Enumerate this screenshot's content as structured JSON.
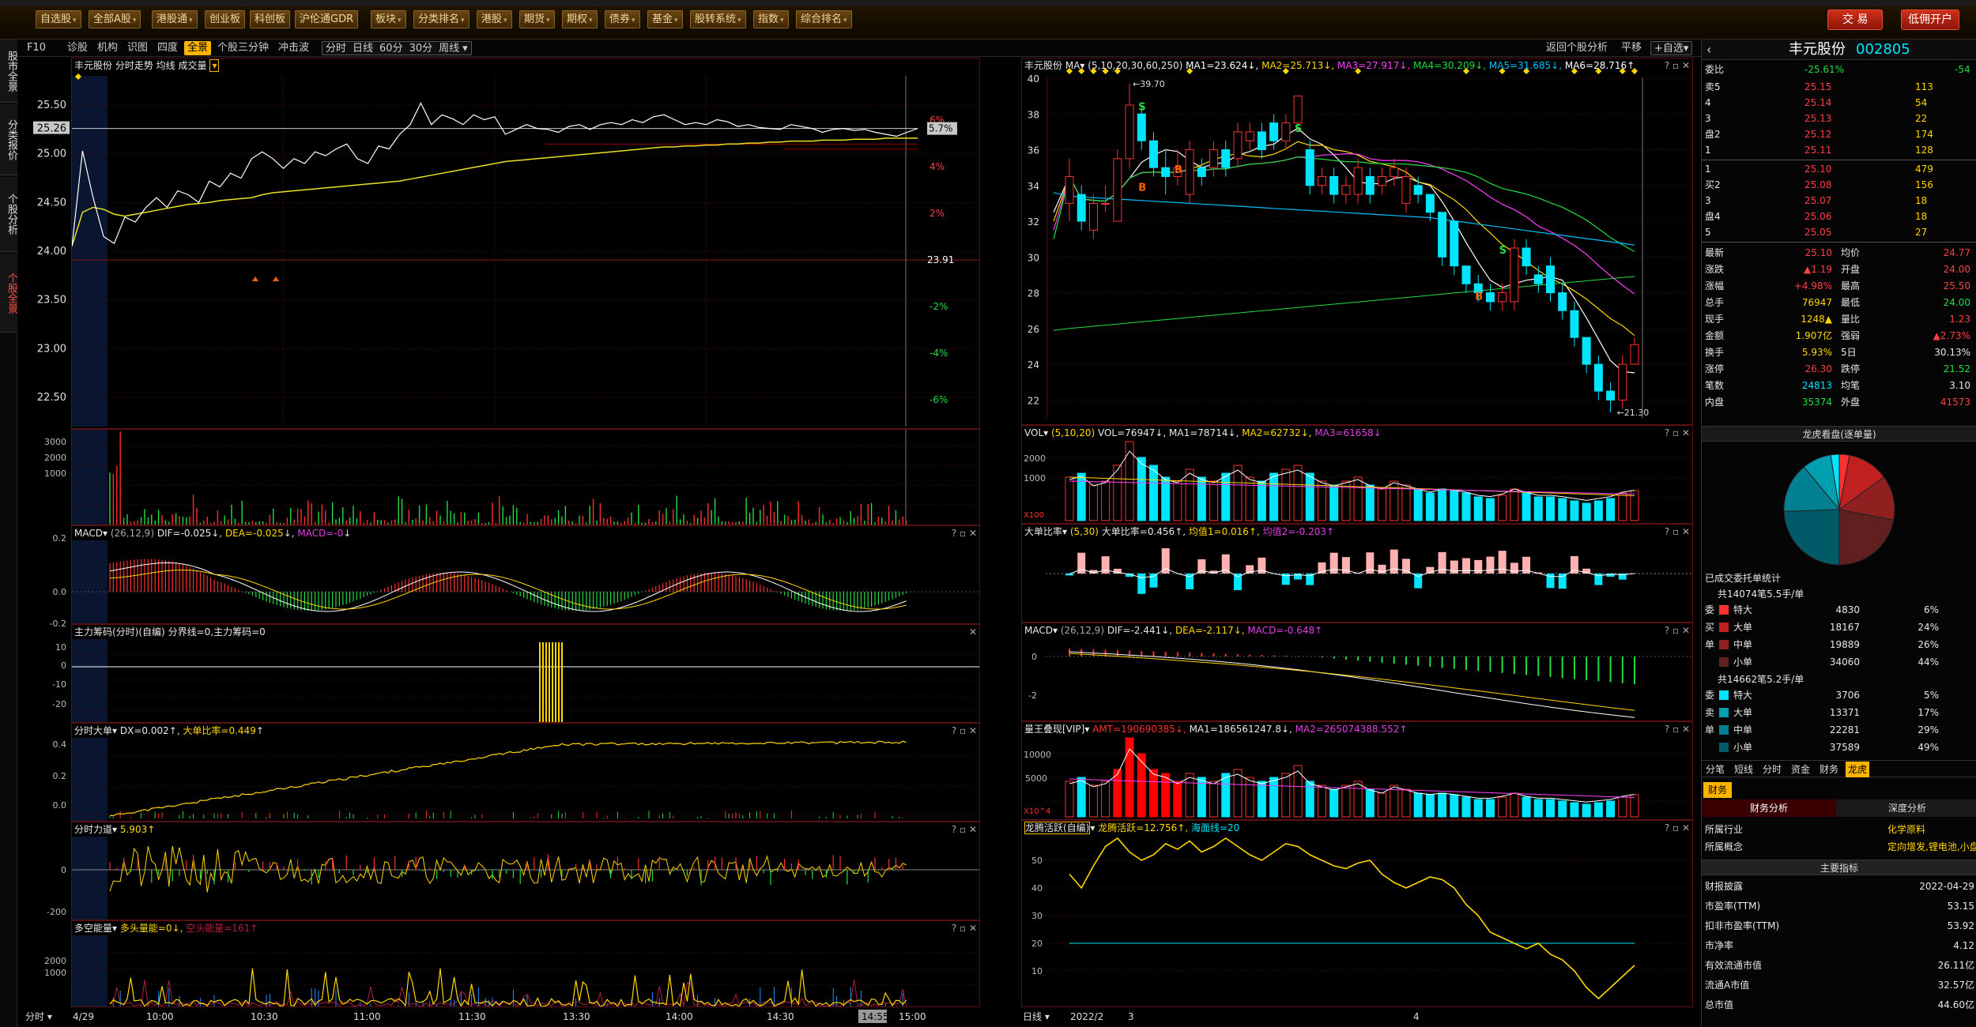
{
  "toolbar": {
    "items": [
      {
        "label": "自选股",
        "arrow": true
      },
      {
        "label": "全部A股",
        "arrow": true
      },
      {
        "label": "港股通",
        "arrow": true
      },
      {
        "label": "创业板",
        "arrow": false
      },
      {
        "label": "科创板",
        "arrow": false
      },
      {
        "label": "沪伦通GDR",
        "arrow": false
      },
      {
        "label": "板块",
        "arrow": true
      },
      {
        "label": "分类排名",
        "arrow": true
      },
      {
        "label": "港股",
        "arrow": true
      },
      {
        "label": "期货",
        "arrow": true
      },
      {
        "label": "期权",
        "arrow": true
      },
      {
        "label": "债券",
        "arrow": true
      },
      {
        "label": "基金",
        "arrow": true
      },
      {
        "label": "股转系统",
        "arrow": true
      },
      {
        "label": "指数",
        "arrow": true
      },
      {
        "label": "综合排名",
        "arrow": true
      }
    ],
    "trade_button": "交 易",
    "open_account_button": "低佣开户"
  },
  "left_strip": [
    {
      "label": "股市全景",
      "active": false
    },
    {
      "label": "分类报价",
      "active": false
    },
    {
      "label": "个股分析",
      "active": false
    },
    {
      "label": "个股全景",
      "active": true
    }
  ],
  "subtabs": {
    "left": [
      "F10",
      "诊股",
      "机构",
      "识图",
      "四度",
      "全景",
      "个股三分钟",
      "冲击波"
    ],
    "left_active": "全景",
    "periods": [
      "分时",
      "日线",
      "60分",
      "30分",
      "周线"
    ],
    "right": [
      "返回个股分析",
      "平移",
      "自选"
    ]
  },
  "intraday": {
    "header": "丰元股份  分时走势  均线  成交量",
    "price_ticks": [
      "25.50",
      "25.00",
      "24.50",
      "24.00",
      "23.50",
      "23.00",
      "22.50"
    ],
    "pct_ticks": [
      "6%",
      "4%",
      "2%",
      "-2%",
      "-4%",
      "-6%"
    ],
    "current_price": "25.26",
    "current_pct": "5.7%",
    "prev_close": "23.91",
    "vol_ticks": [
      "3000",
      "2000",
      "1000"
    ],
    "time_axis": [
      "分时",
      "4/29",
      "10:00",
      "10:30",
      "11:00",
      "11:30",
      "13:30",
      "14:00",
      "14:30",
      "14:55",
      "15:00"
    ]
  },
  "macd_intraday": {
    "name": "MACD",
    "params": "(26,12,9)",
    "dif": "DIF=-0.025",
    "dea": "DEA=-0.025",
    "macd": "MACD=-0",
    "ticks": [
      "0.2",
      "0.0",
      "-0.2"
    ]
  },
  "chip": {
    "name": "主力筹码(分时)(自编)",
    "text": "分界线=0,主力筹码=0",
    "ticks": [
      "10",
      "0",
      "-10",
      "-20"
    ]
  },
  "bigorder": {
    "name": "分时大单",
    "dx": "DX=0.002",
    "ratio": "大单比率=0.449",
    "ticks": [
      "0.4",
      "0.2",
      "0.0"
    ]
  },
  "force": {
    "name": "分时力道",
    "value": "5.903",
    "ticks": [
      "0",
      "-200"
    ]
  },
  "longshort": {
    "name": "多空能量",
    "bull": "多头量能=0",
    "bear": "空头能量=161",
    "ticks": [
      "2000",
      "1000"
    ]
  },
  "kline": {
    "header_name": "丰元股份",
    "ma_params": "(5,10,20,30,60,250)",
    "ma": [
      {
        "label": "MA1=23.624",
        "color": "#ffffff"
      },
      {
        "label": "MA2=25.713",
        "color": "#ffd700"
      },
      {
        "label": "MA3=27.917",
        "color": "#ff40ff"
      },
      {
        "label": "MA4=30.209",
        "color": "#22dd44"
      },
      {
        "label": "MA5=31.685",
        "color": "#00bfff"
      },
      {
        "label": "MA6=28.716",
        "color": "#ffffff"
      }
    ],
    "price_ticks": [
      "40",
      "38",
      "36",
      "34",
      "32",
      "30",
      "28",
      "26",
      "24",
      "22"
    ],
    "high_label": "39.70",
    "low_label": "21.30",
    "date_axis": [
      "日线",
      "2022/2",
      "3",
      "4"
    ],
    "signals": [
      "S",
      "S",
      "S",
      "B",
      "B",
      "B"
    ]
  },
  "vol": {
    "name": "VOL",
    "params": "(5,10,20)",
    "vol": "VOL=76947",
    "ma1": "MA1=78714",
    "ma2": "MA2=62732",
    "ma3": "MA3=61658",
    "ticks": [
      "2000",
      "1000"
    ],
    "unit": "X100"
  },
  "bigratio": {
    "name": "大单比率",
    "params": "(5,30)",
    "val": "大单比率=0.456",
    "avg1": "均值1=0.016",
    "avg2": "均值2=-0.203"
  },
  "macd_daily": {
    "name": "MACD",
    "params": "(26,12,9)",
    "dif": "DIF=-2.441",
    "dea": "DEA=-2.117",
    "macd": "MACD=-0.648",
    "ticks": [
      "0",
      "-2"
    ]
  },
  "volking": {
    "name": "量王叠现[VIP]",
    "amt": "AMT=190690385",
    "ma1": "MA1=186561247.8",
    "ma2": "MA2=265074388.552",
    "ticks": [
      "10000",
      "5000"
    ],
    "unit": "X10^4"
  },
  "dragon": {
    "name": "龙腾活跃(自编)",
    "val": "龙腾活跃=12.756",
    "sea": "海面线=20",
    "ticks": [
      "50",
      "40",
      "30",
      "20",
      "10"
    ]
  },
  "side": {
    "stock_name": "丰元股份",
    "stock_code": "002805",
    "weibi_label": "委比",
    "weibi": "-25.61%",
    "weicha": "-54",
    "asks": [
      {
        "label": "卖5",
        "price": "25.15",
        "vol": "113"
      },
      {
        "label": "4",
        "price": "25.14",
        "vol": "54"
      },
      {
        "label": "3",
        "price": "25.13",
        "vol": "22"
      },
      {
        "label": "盘2",
        "price": "25.12",
        "vol": "174"
      },
      {
        "label": "1",
        "price": "25.11",
        "vol": "128"
      }
    ],
    "bids": [
      {
        "label": "1",
        "price": "25.10",
        "vol": "479"
      },
      {
        "label": "买2",
        "price": "25.08",
        "vol": "156"
      },
      {
        "label": "3",
        "price": "25.07",
        "vol": "18"
      },
      {
        "label": "盘4",
        "price": "25.06",
        "vol": "18"
      },
      {
        "label": "5",
        "price": "25.05",
        "vol": "27"
      }
    ],
    "quotes": [
      {
        "l1": "最新",
        "v1": "25.10",
        "c1": "red",
        "l2": "均价",
        "v2": "24.77",
        "c2": "red"
      },
      {
        "l1": "涨跌",
        "v1": "▲1.19",
        "c1": "red",
        "l2": "开盘",
        "v2": "24.00",
        "c2": "red"
      },
      {
        "l1": "涨幅",
        "v1": "+4.98%",
        "c1": "red",
        "l2": "最高",
        "v2": "25.50",
        "c2": "red"
      },
      {
        "l1": "总手",
        "v1": "76947",
        "c1": "yellow",
        "l2": "最低",
        "v2": "24.00",
        "c2": "green"
      },
      {
        "l1": "现手",
        "v1": "1248▲",
        "c1": "yellow",
        "l2": "量比",
        "v2": "1.23",
        "c2": "red"
      },
      {
        "l1": "金额",
        "v1": "1.907亿",
        "c1": "yellow",
        "l2": "强弱",
        "v2": "▲2.73%",
        "c2": "red"
      },
      {
        "l1": "换手",
        "v1": "5.93%",
        "c1": "yellow",
        "l2": "5日",
        "v2": "30.13%",
        "c2": "white"
      },
      {
        "l1": "涨停",
        "v1": "26.30",
        "c1": "red",
        "l2": "跌停",
        "v2": "21.52",
        "c2": "green"
      },
      {
        "l1": "笔数",
        "v1": "24813",
        "c1": "cyan",
        "l2": "均笔",
        "v2": "3.10",
        "c2": "white"
      },
      {
        "l1": "内盘",
        "v1": "35374",
        "c1": "green",
        "l2": "外盘",
        "v2": "41573",
        "c2": "red"
      }
    ],
    "pie_title": "龙虎看盘(逐单量)",
    "entrust_title": "已成交委托单统计",
    "buy_total": "共14074笔5.5手/单",
    "buy_rows": [
      {
        "side": "委",
        "cat": "特大",
        "num": "4830",
        "pct": "6%",
        "color": "#ff3030"
      },
      {
        "side": "买",
        "cat": "大单",
        "num": "18167",
        "pct": "24%",
        "color": "#c02020"
      },
      {
        "side": "单",
        "cat": "中单",
        "num": "19889",
        "pct": "26%",
        "color": "#902020"
      },
      {
        "side": "",
        "cat": "小单",
        "num": "34060",
        "pct": "44%",
        "color": "#602020"
      }
    ],
    "sell_total": "共14662笔5.2手/单",
    "sell_rows": [
      {
        "side": "委",
        "cat": "特大",
        "num": "3706",
        "pct": "5%",
        "color": "#00e5ff"
      },
      {
        "side": "卖",
        "cat": "大单",
        "num": "13371",
        "pct": "17%",
        "color": "#00a0b0"
      },
      {
        "side": "单",
        "cat": "中单",
        "num": "22281",
        "pct": "29%",
        "color": "#008090"
      },
      {
        "side": "",
        "cat": "小单",
        "num": "37589",
        "pct": "49%",
        "color": "#005a68"
      }
    ],
    "tabs": [
      "分笔",
      "短线",
      "分时",
      "资金",
      "财务",
      "龙虎"
    ],
    "tabs_active": "龙虎",
    "fin_tab": "财务",
    "fin_sub": [
      "财务分析",
      "深度分析"
    ],
    "fin_rows": [
      {
        "l": "所属行业",
        "v": "化学原料"
      },
      {
        "l": "所属概念",
        "v": "定向增发,锂电池,小盘"
      }
    ],
    "main_title": "主要指标",
    "main_rows": [
      {
        "l": "财报披露",
        "v": "2022-04-29"
      },
      {
        "l": "市盈率(TTM)",
        "v": "53.15"
      },
      {
        "l": "扣非市盈率(TTM)",
        "v": "53.92"
      },
      {
        "l": "市净率",
        "v": "4.12"
      },
      {
        "l": "有效流通市值",
        "v": "26.11亿"
      },
      {
        "l": "流通A市值",
        "v": "32.57亿"
      },
      {
        "l": "总市值",
        "v": "44.60亿"
      }
    ]
  },
  "chart_data": [
    {
      "type": "line",
      "title": "丰元股份 分时走势",
      "ylim": [
        22.2,
        25.8
      ],
      "prev_close": 23.91,
      "x": [
        "09:30",
        "09:33",
        "09:36",
        "09:39",
        "09:42",
        "09:45",
        "09:48",
        "09:51",
        "09:54",
        "09:57",
        "10:00",
        "10:03",
        "10:06",
        "10:09",
        "10:12",
        "10:15",
        "10:18",
        "10:21",
        "10:24",
        "10:27",
        "10:30",
        "10:33",
        "10:36",
        "10:39",
        "10:42",
        "10:45",
        "10:48",
        "10:51",
        "10:54",
        "10:57",
        "11:00",
        "11:03",
        "11:06",
        "11:09",
        "11:12",
        "11:15",
        "11:18",
        "11:21",
        "11:24",
        "11:27",
        "11:30",
        "13:03",
        "13:06",
        "13:09",
        "13:12",
        "13:15",
        "13:18",
        "13:21",
        "13:24",
        "13:27",
        "13:30",
        "13:33",
        "13:36",
        "13:39",
        "13:42",
        "13:45",
        "13:48",
        "13:51",
        "13:54",
        "13:57",
        "14:00",
        "14:03",
        "14:06",
        "14:09",
        "14:12",
        "14:15",
        "14:18",
        "14:21",
        "14:24",
        "14:27",
        "14:30",
        "14:33",
        "14:36",
        "14:39",
        "14:42",
        "14:45",
        "14:48",
        "14:51",
        "14:54",
        "14:57",
        "15:00"
      ],
      "series": [
        {
          "name": "价格",
          "values": [
            24.05,
            25.03,
            24.55,
            24.15,
            24.08,
            24.35,
            24.3,
            24.45,
            24.55,
            24.45,
            24.62,
            24.58,
            24.5,
            24.72,
            24.66,
            24.8,
            24.75,
            24.95,
            25.02,
            24.95,
            24.85,
            24.95,
            24.9,
            25.02,
            24.98,
            25.05,
            25.1,
            24.95,
            24.9,
            25.08,
            25.05,
            25.2,
            25.3,
            25.52,
            25.3,
            25.4,
            25.36,
            25.3,
            25.4,
            25.35,
            25.38,
            25.2,
            25.25,
            25.3,
            25.26,
            25.25,
            25.22,
            25.28,
            25.3,
            25.25,
            25.3,
            25.32,
            25.3,
            25.35,
            25.32,
            25.38,
            25.4,
            25.35,
            25.3,
            25.32,
            25.3,
            25.35,
            25.33,
            25.28,
            25.3,
            25.27,
            25.26,
            25.25,
            25.3,
            25.28,
            25.26,
            25.22,
            25.25,
            25.26,
            25.24,
            25.25,
            25.22,
            25.2,
            25.18,
            25.22,
            25.26
          ]
        },
        {
          "name": "均线",
          "values": [
            24.05,
            24.4,
            24.45,
            24.43,
            24.38,
            24.36,
            24.38,
            24.4,
            24.42,
            24.44,
            24.46,
            24.48,
            24.49,
            24.5,
            24.52,
            24.53,
            24.54,
            24.55,
            24.58,
            24.6,
            24.61,
            24.62,
            24.63,
            24.64,
            24.65,
            24.66,
            24.67,
            24.68,
            24.69,
            24.7,
            24.71,
            24.72,
            24.74,
            24.76,
            24.78,
            24.8,
            24.82,
            24.84,
            24.86,
            24.88,
            24.9,
            24.92,
            24.93,
            24.94,
            24.95,
            24.96,
            24.97,
            24.98,
            24.99,
            25.0,
            25.01,
            25.02,
            25.03,
            25.04,
            25.05,
            25.06,
            25.07,
            25.07,
            25.08,
            25.08,
            25.09,
            25.09,
            25.1,
            25.1,
            25.11,
            25.11,
            25.12,
            25.12,
            25.13,
            25.13,
            25.13,
            25.14,
            25.14,
            25.14,
            25.15,
            25.15,
            25.15,
            25.16,
            25.16,
            25.16,
            25.16
          ]
        }
      ]
    },
    {
      "type": "candlestick",
      "title": "丰元股份 日线",
      "ylim": [
        21,
        40
      ],
      "x": [
        "2022/2/21",
        "2/22",
        "2/23",
        "2/24",
        "2/25",
        "2/28",
        "3/1",
        "3/2",
        "3/3",
        "3/4",
        "3/7",
        "3/8",
        "3/9",
        "3/10",
        "3/11",
        "3/14",
        "3/15",
        "3/16",
        "3/17",
        "3/18",
        "3/21",
        "3/22",
        "3/23",
        "3/24",
        "3/25",
        "3/28",
        "3/29",
        "3/30",
        "3/31",
        "4/1",
        "4/6",
        "4/7",
        "4/8",
        "4/11",
        "4/12",
        "4/13",
        "4/14",
        "4/15",
        "4/18",
        "4/19",
        "4/20",
        "4/21",
        "4/22",
        "4/25",
        "4/26",
        "4/27",
        "4/28",
        "4/29"
      ],
      "open": [
        33.0,
        33.5,
        31.5,
        33.0,
        32.0,
        35.5,
        38.0,
        36.5,
        35.0,
        34.5,
        33.5,
        35.0,
        35.0,
        36.0,
        35.5,
        36.5,
        37.0,
        37.5,
        36.5,
        37.5,
        36.0,
        34.0,
        34.5,
        33.5,
        33.5,
        34.5,
        34.0,
        34.5,
        33.0,
        34.0,
        33.5,
        32.5,
        32.0,
        29.5,
        28.5,
        28.0,
        27.5,
        27.5,
        30.5,
        29.0,
        29.5,
        28.0,
        27.0,
        25.5,
        24.0,
        22.5,
        22.0,
        24.0
      ],
      "close": [
        34.5,
        32.0,
        33.0,
        33.0,
        35.5,
        38.5,
        36.5,
        35.0,
        34.5,
        35.0,
        36.0,
        34.5,
        36.0,
        35.0,
        37.0,
        37.0,
        36.0,
        36.5,
        37.5,
        39.0,
        34.0,
        34.5,
        33.5,
        34.0,
        35.0,
        33.5,
        34.5,
        35.0,
        34.5,
        33.5,
        32.5,
        30.0,
        29.5,
        28.5,
        28.0,
        27.5,
        28.0,
        30.5,
        29.5,
        28.5,
        28.0,
        27.0,
        25.5,
        24.0,
        22.5,
        22.0,
        24.0,
        25.1
      ],
      "high": [
        35.5,
        34.0,
        33.5,
        34.0,
        36.0,
        39.7,
        38.5,
        37.0,
        36.0,
        36.0,
        36.5,
        35.5,
        36.5,
        36.5,
        37.5,
        37.5,
        37.5,
        38.0,
        38.0,
        39.0,
        36.5,
        35.0,
        35.0,
        34.5,
        35.5,
        35.0,
        35.0,
        35.5,
        35.0,
        34.5,
        33.5,
        32.5,
        32.0,
        29.5,
        29.0,
        28.5,
        28.5,
        31.0,
        31.0,
        29.5,
        30.0,
        28.5,
        27.5,
        25.5,
        24.5,
        23.0,
        24.5,
        25.5
      ],
      "low": [
        32.0,
        31.5,
        31.0,
        32.5,
        32.0,
        35.0,
        36.0,
        34.5,
        33.5,
        34.0,
        33.0,
        34.0,
        34.5,
        34.5,
        35.0,
        36.0,
        35.5,
        36.0,
        36.0,
        37.0,
        33.5,
        33.5,
        33.0,
        33.0,
        33.0,
        33.0,
        33.5,
        34.0,
        32.5,
        33.0,
        32.0,
        29.5,
        29.0,
        28.0,
        27.5,
        27.0,
        27.0,
        27.0,
        29.0,
        28.0,
        27.5,
        26.5,
        25.0,
        23.5,
        22.0,
        21.3,
        21.5,
        24.0
      ]
    }
  ]
}
